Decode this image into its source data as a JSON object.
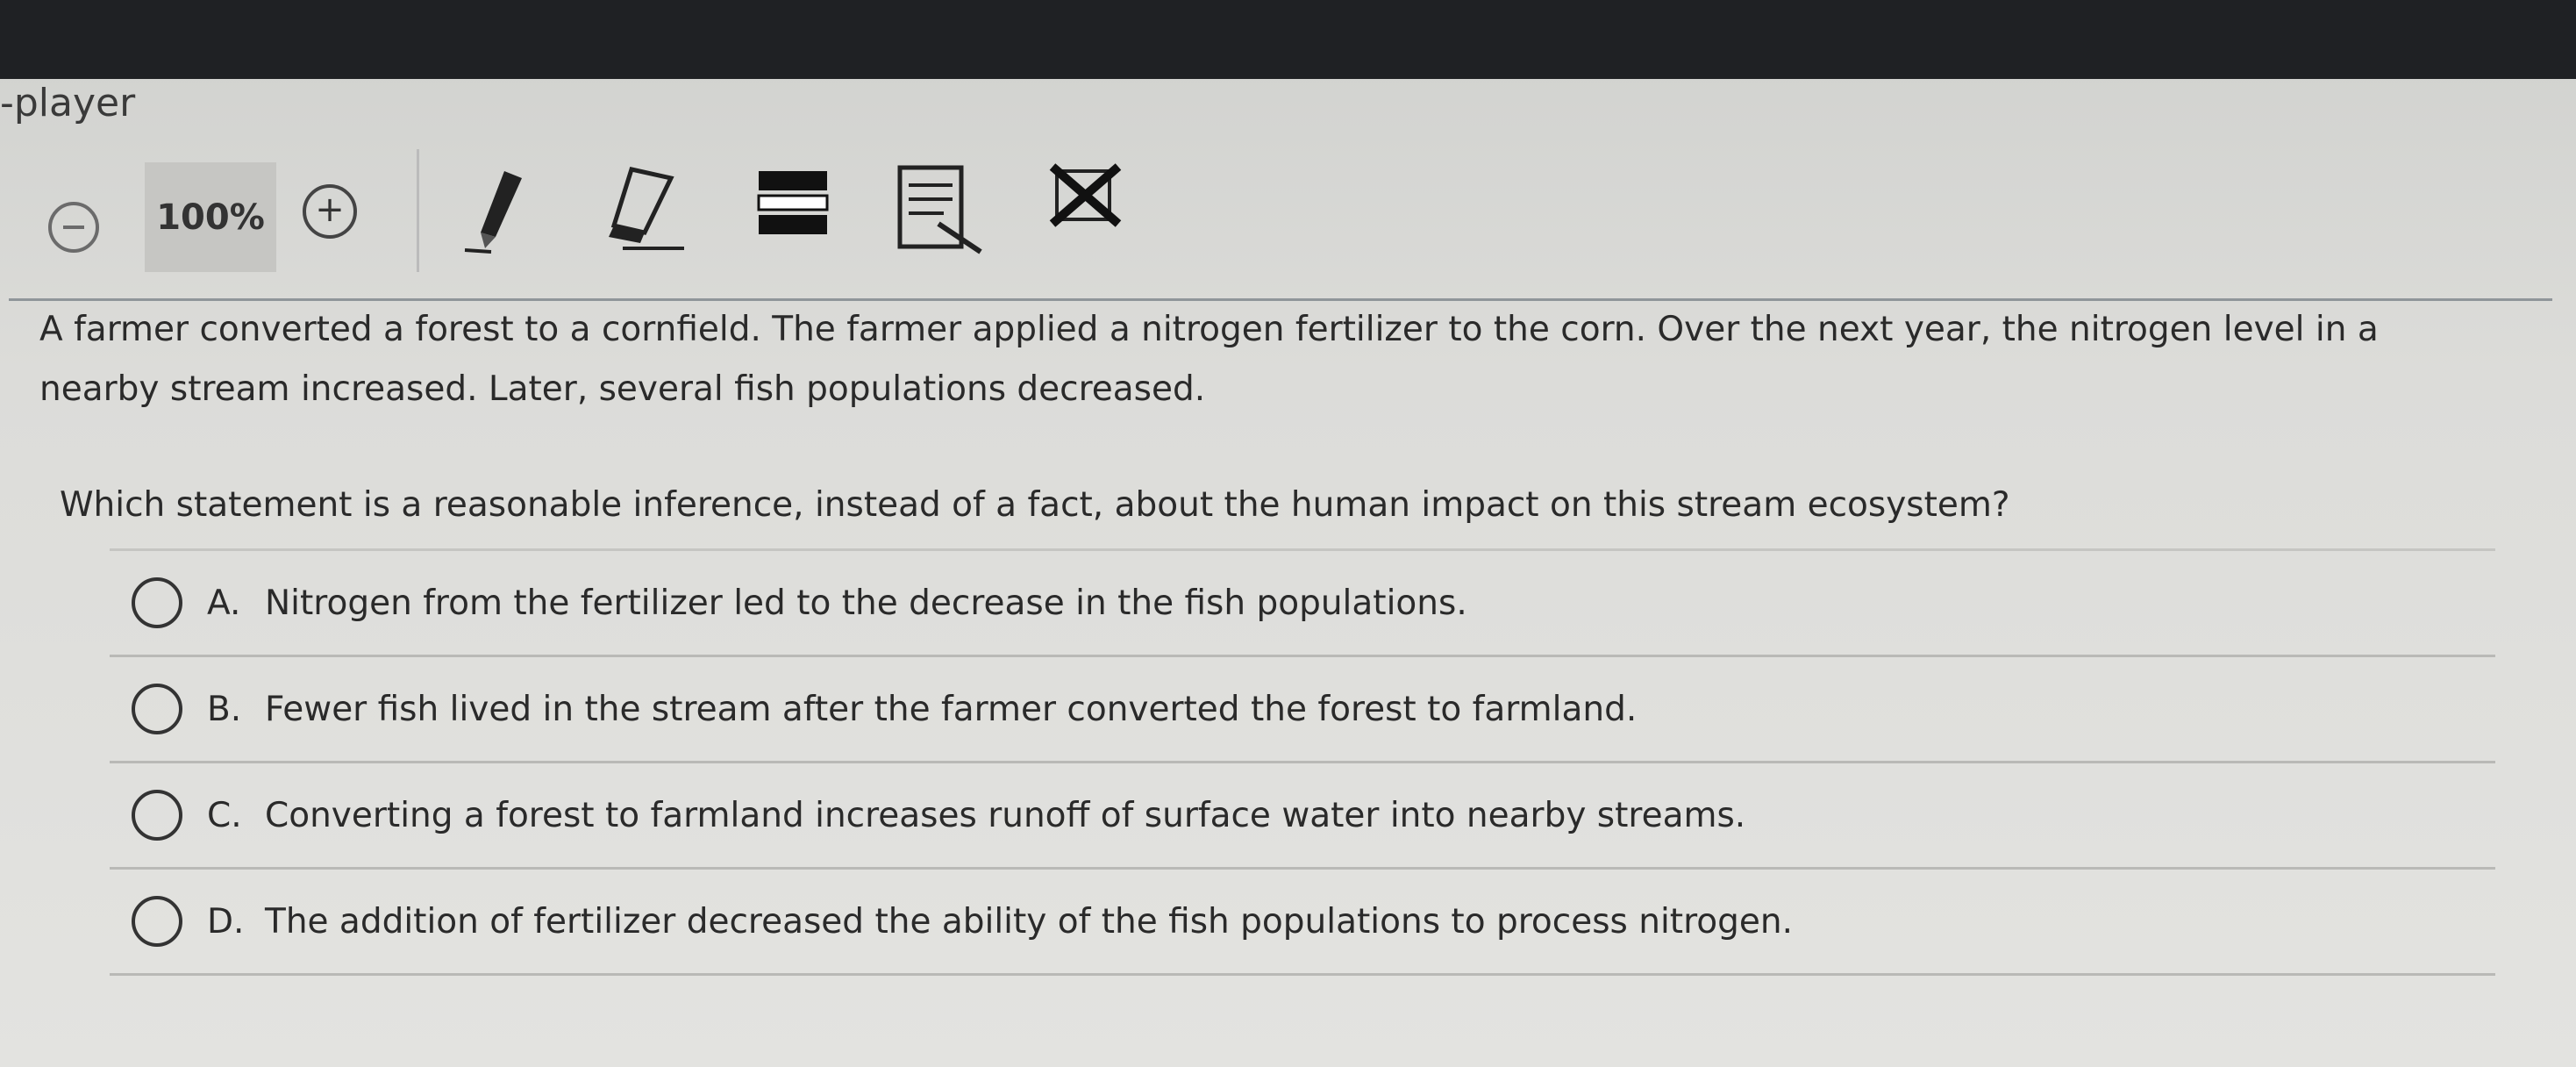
{
  "app": {
    "title": "-player"
  },
  "toolbar": {
    "zoom_level": "100%",
    "zoom_out_symbol": "−",
    "zoom_in_symbol": "+",
    "tools": [
      "pencil-icon",
      "eraser-icon",
      "line-reader-icon",
      "notepad-icon",
      "answer-eliminator-icon"
    ]
  },
  "question": {
    "passage_line1": "A farmer converted a forest to a cornfield. The farmer applied a nitrogen fertilizer to the corn. Over the next year, the nitrogen level in a",
    "passage_line2": "nearby stream increased. Later, several fish populations decreased.",
    "prompt": "Which statement is a reasonable inference, instead of a fact, about the human impact on this stream ecosystem?",
    "choices": [
      {
        "letter": "A.",
        "text": "Nitrogen from the fertilizer led to the decrease in the fish populations."
      },
      {
        "letter": "B.",
        "text": "Fewer fish lived in the stream after the farmer converted the forest to farmland."
      },
      {
        "letter": "C.",
        "text": "Converting a forest to farmland increases runoff of surface water into nearby streams."
      },
      {
        "letter": "D.",
        "text": "The addition of fertilizer decreased the ability of the fish populations to process nitrogen."
      }
    ]
  }
}
